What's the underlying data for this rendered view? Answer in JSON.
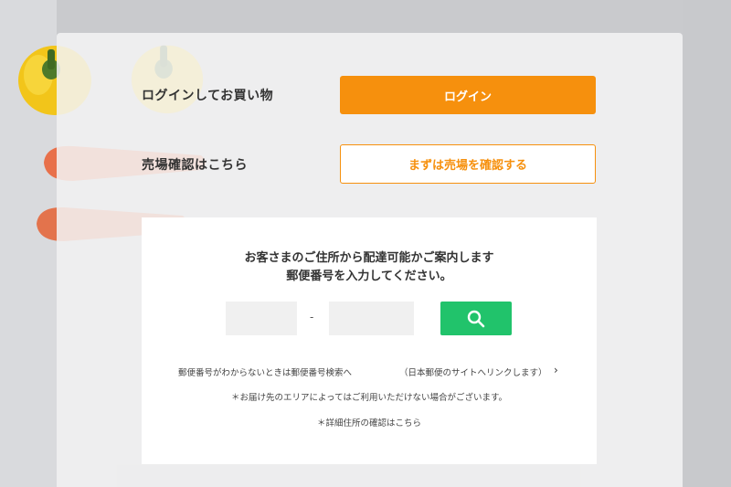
{
  "login_row": {
    "label": "ログインしてお買い物",
    "button": "ログイン"
  },
  "store_row": {
    "label": "売場確認はこちら",
    "button": "まずは売場を確認する"
  },
  "postal": {
    "title_line1": "お客さまのご住所から配達可能かご案内します",
    "title_line2": "郵便番号を入力してください。",
    "zip1_value": "",
    "zip2_value": "",
    "separator": "-",
    "search_icon": "search-icon",
    "lookup_link": "郵便番号がわからないときは郵便番号検索へ",
    "japanpost_link": "（日本郵便のサイトへリンクします）",
    "chevron": "›",
    "note": "＊お届け先のエリアによってはご利用いただけない場合がございます。",
    "detail_link": "＊詳細住所の確認はこちら"
  },
  "colors": {
    "accent": "#f6900d",
    "search_green": "#21c36b"
  }
}
